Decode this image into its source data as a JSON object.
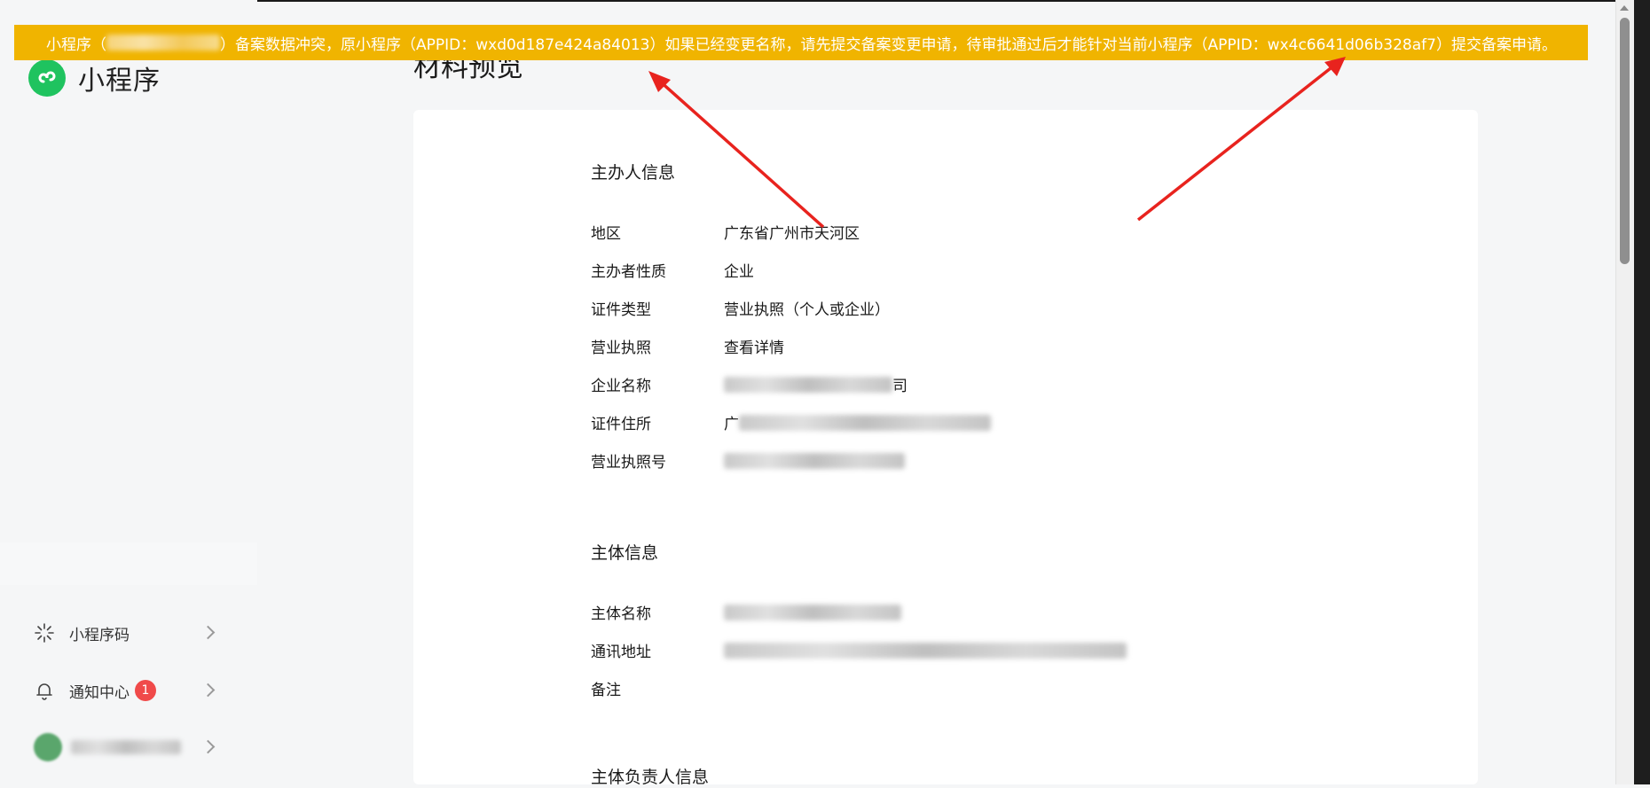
{
  "app": {
    "name": "小程序"
  },
  "page": {
    "title": "材料预览"
  },
  "banner": {
    "prefix": "小程序（",
    "suffix": "）备案数据冲突，原小程序（APPID：wxd0d187e424a84013）如果已经变更名称，请先提交备案变更申请，待审批通过后才能针对当前小程序（APPID：wx4c6641d06b328af7）提交备案申请。"
  },
  "sidebar": {
    "items": [
      {
        "label": "小程序码"
      },
      {
        "label": "通知中心",
        "badge": "1"
      }
    ]
  },
  "sections": {
    "sponsor": {
      "title": "主办人信息",
      "rows": [
        {
          "key": "地区",
          "value": "广东省广州市天河区"
        },
        {
          "key": "主办者性质",
          "value": "企业"
        },
        {
          "key": "证件类型",
          "value": "营业执照（个人或企业）"
        },
        {
          "key": "营业执照",
          "value": "查看详情"
        },
        {
          "key": "企业名称",
          "value": "司"
        },
        {
          "key": "证件住所",
          "value": "广"
        },
        {
          "key": "营业执照号",
          "value": ""
        }
      ]
    },
    "subject": {
      "title": "主体信息",
      "rows": [
        {
          "key": "主体名称",
          "value": ""
        },
        {
          "key": "通讯地址",
          "value": ""
        },
        {
          "key": "备注",
          "value": ""
        }
      ]
    },
    "owner": {
      "title": "主体负责人信息"
    }
  },
  "colors": {
    "banner": "#f0b400",
    "logo": "#1fc35f",
    "link": "#576b95",
    "badge": "#f04a4a",
    "arrow": "#e8231e"
  }
}
